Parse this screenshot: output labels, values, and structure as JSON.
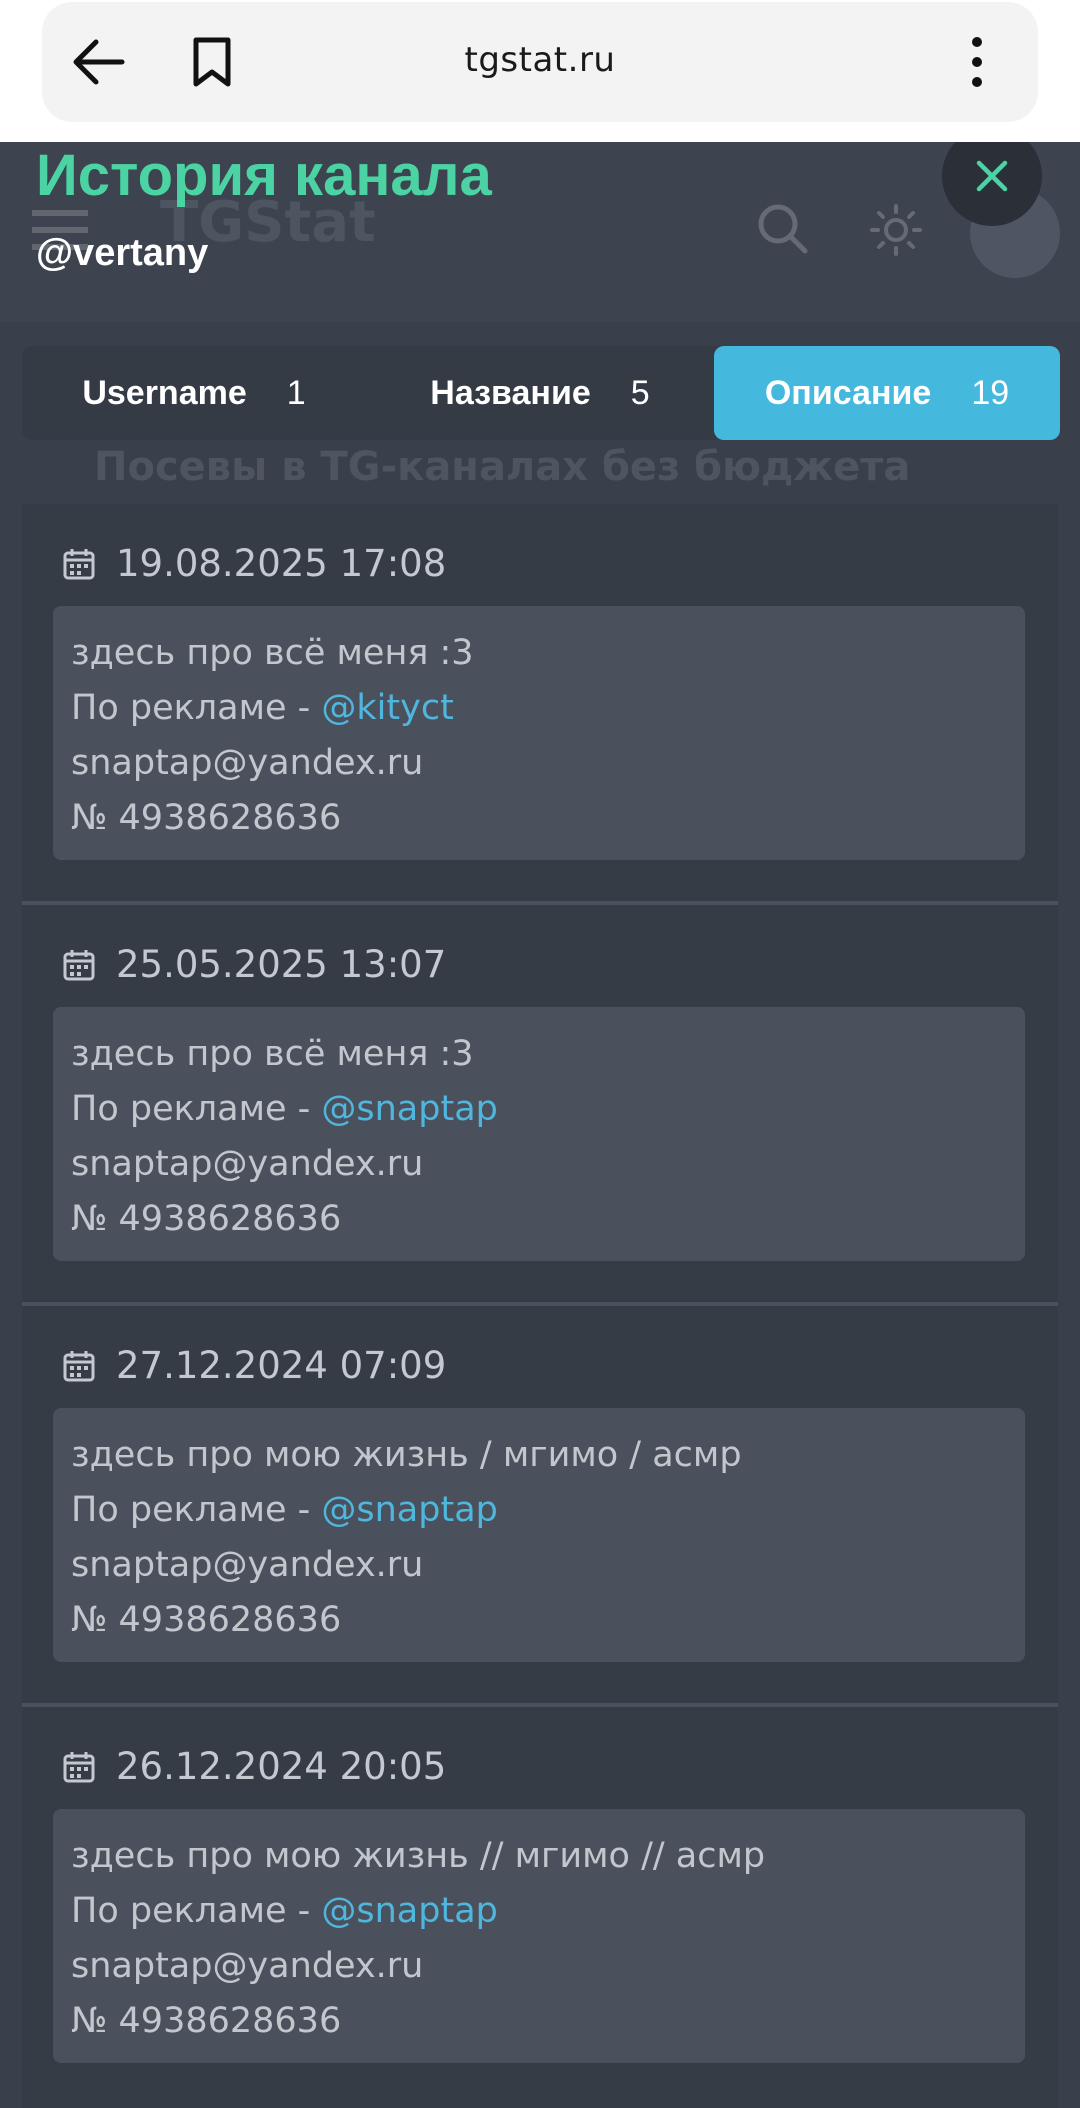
{
  "browser": {
    "url": "tgstat.ru",
    "back_icon": "arrow-left-icon",
    "bookmark_icon": "bookmark-icon",
    "menu_icon": "kebab-menu-icon"
  },
  "background": {
    "logo_text": "TGStat",
    "banner_text": "Посевы в TG-каналах без бюджета"
  },
  "modal": {
    "title": "История канала",
    "subtitle": "@vertany",
    "close_icon": "close-icon",
    "title_color": "#4cd3a3",
    "accent_color": "#45b8de"
  },
  "tabs": [
    {
      "label": "Username",
      "count": "1",
      "active": false
    },
    {
      "label": "Название",
      "count": "5",
      "active": false
    },
    {
      "label": "Описание",
      "count": "19",
      "active": true
    }
  ],
  "entries": [
    {
      "date": "19.08.2025 17:08",
      "line1": "здесь про всё меня :3",
      "ad_prefix": "По рекламе - ",
      "ad_mention": "@kityct",
      "email": "snaptap@yandex.ru",
      "number": "№ 4938628636"
    },
    {
      "date": "25.05.2025 13:07",
      "line1": "здесь про всё меня :3",
      "ad_prefix": "По рекламе - ",
      "ad_mention": "@snaptap",
      "email": "snaptap@yandex.ru",
      "number": "№ 4938628636"
    },
    {
      "date": "27.12.2024 07:09",
      "line1": "здесь про мою жизнь / мгимо / асмр",
      "ad_prefix": "По рекламе - ",
      "ad_mention": "@snaptap",
      "email": "snaptap@yandex.ru",
      "number": "№ 4938628636"
    },
    {
      "date": "26.12.2024 20:05",
      "line1": "здесь про мою жизнь // мгимо // асмр",
      "ad_prefix": "По рекламе - ",
      "ad_mention": "@snaptap",
      "email": "snaptap@yandex.ru",
      "number": "№ 4938628636"
    }
  ]
}
